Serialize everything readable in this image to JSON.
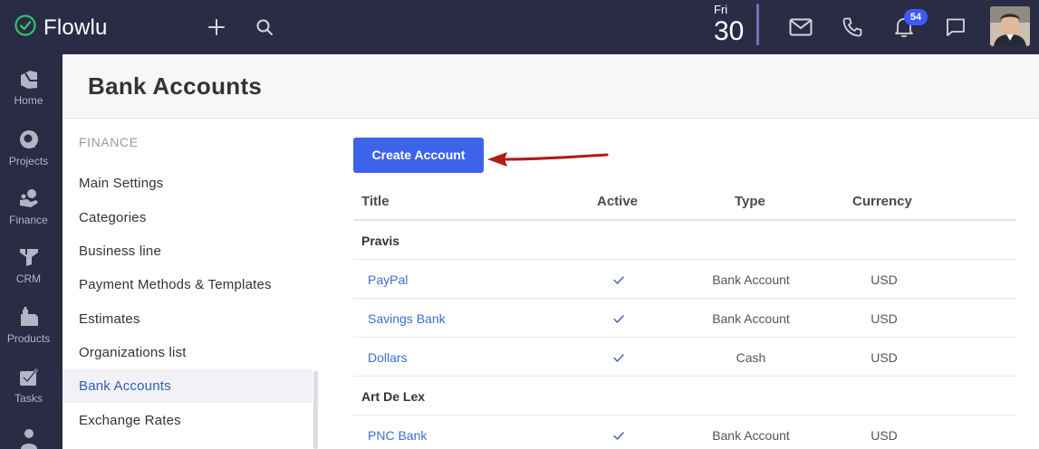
{
  "app": {
    "brand": "Flowlu",
    "date_day": "Fri",
    "date_num": "30",
    "notifications_count": "54",
    "accent_color": "#3d63ea",
    "topbar_color": "#2a2b45"
  },
  "topbar_icons": [
    "add-icon",
    "search-icon",
    "mail-icon",
    "phone-icon",
    "bell-icon",
    "chat-icon"
  ],
  "leftnav": {
    "items": [
      {
        "label": "Home",
        "icon": "home-icon"
      },
      {
        "label": "Projects",
        "icon": "projects-icon"
      },
      {
        "label": "Finance",
        "icon": "finance-icon"
      },
      {
        "label": "CRM",
        "icon": "crm-icon"
      },
      {
        "label": "Products",
        "icon": "products-icon"
      },
      {
        "label": "Tasks",
        "icon": "tasks-icon"
      }
    ]
  },
  "page": {
    "title": "Bank Accounts"
  },
  "settings_menu": {
    "section": "FINANCE",
    "items": [
      {
        "label": "Main Settings"
      },
      {
        "label": "Categories"
      },
      {
        "label": "Business line"
      },
      {
        "label": "Payment Methods & Templates"
      },
      {
        "label": "Estimates"
      },
      {
        "label": "Organizations list"
      },
      {
        "label": "Bank Accounts",
        "active": true
      },
      {
        "label": "Exchange Rates"
      }
    ]
  },
  "content": {
    "create_button": "Create Account",
    "columns": {
      "title": "Title",
      "active": "Active",
      "type": "Type",
      "currency": "Currency"
    },
    "groups": [
      {
        "name": "Pravis",
        "rows": [
          {
            "title": "PayPal",
            "active": true,
            "type": "Bank Account",
            "currency": "USD"
          },
          {
            "title": "Savings Bank",
            "active": true,
            "type": "Bank Account",
            "currency": "USD"
          },
          {
            "title": "Dollars",
            "active": true,
            "type": "Cash",
            "currency": "USD"
          }
        ]
      },
      {
        "name": "Art De Lex",
        "rows": [
          {
            "title": "PNC Bank",
            "active": true,
            "type": "Bank Account",
            "currency": "USD"
          }
        ]
      }
    ]
  }
}
